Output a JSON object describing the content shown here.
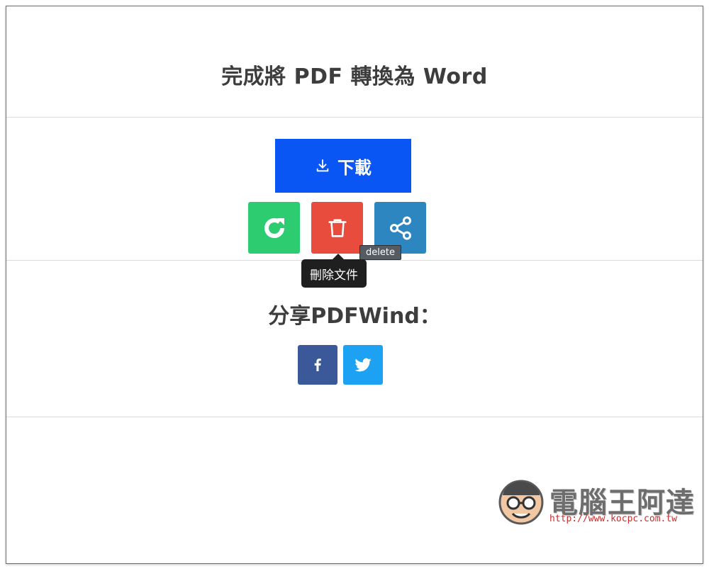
{
  "dialog": {
    "title": "完成將 PDF 轉換為 Word",
    "download_label": "下載",
    "actions": [
      {
        "name": "redo",
        "icon": "refresh-icon",
        "color": "#2ecc71"
      },
      {
        "name": "delete",
        "icon": "trash-icon",
        "color": "#e74c3c"
      },
      {
        "name": "share",
        "icon": "share-icon",
        "color": "#2e86c1"
      }
    ],
    "tooltip_small": "delete",
    "tooltip_main": "刪除文件",
    "share_heading": "分享PDFWind：",
    "social": [
      {
        "name": "facebook",
        "icon": "facebook-icon",
        "color": "#3b5998"
      },
      {
        "name": "twitter",
        "icon": "twitter-icon",
        "color": "#1da1f2"
      }
    ]
  },
  "watermark": {
    "text": "電腦王阿達",
    "url": "http://www.kocpc.com.tw"
  },
  "colors": {
    "download": "#0a56f5",
    "title_text": "#3d3d3d"
  }
}
